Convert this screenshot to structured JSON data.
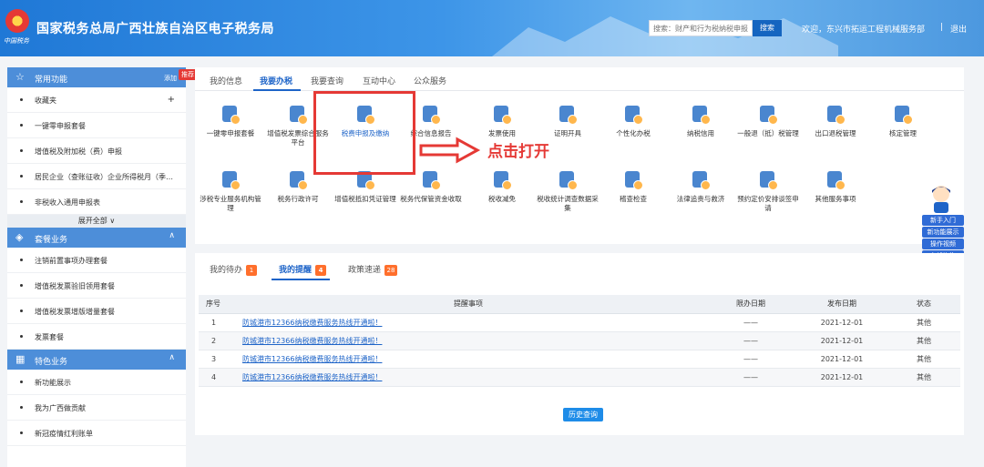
{
  "header": {
    "title": "国家税务总局广西壮族自治区电子税务局",
    "emblem_text": "中国税务",
    "search_placeholder": "搜索：财产和行为税纳税申报",
    "search_button": "搜索",
    "welcome": "欢迎，东兴市拓运工程机械服务部",
    "separator": "|",
    "logout": "退出"
  },
  "sidebar": {
    "recommend_badge": "推荐",
    "expand_all": "展开全部 ∨",
    "sections": [
      {
        "title": "常用功能",
        "action": "添加",
        "items": [
          "收藏夹",
          "一键零申报套餐",
          "增值税及附加税（费）申报",
          "居民企业（查账征收）企业所得税月（季…",
          "非税收入通用申报表"
        ]
      },
      {
        "title": "套餐业务",
        "items": [
          "注销前置事项办理套餐",
          "增值税发票验旧领用套餐",
          "增值税发票增版增量套餐",
          "发票套餐"
        ]
      },
      {
        "title": "特色业务",
        "items": [
          "新功能展示",
          "我为广西做贡献",
          "新冠疫情红利账单"
        ]
      }
    ]
  },
  "tabs": [
    "我的信息",
    "我要办税",
    "我要查询",
    "互动中心",
    "公众服务"
  ],
  "functions_row1": [
    "一键零申报套餐",
    "增值税发票综合服务平台",
    "税费申报及缴纳",
    "综合信息报告",
    "发票使用",
    "证明开具",
    "个性化办税",
    "纳税信用",
    "一般退（抵）税管理",
    "出口退税管理",
    "核定管理"
  ],
  "functions_row2": [
    "涉税专业服务机构管理",
    "税务行政许可",
    "增值税抵扣凭证管理",
    "税务代保管资金收取",
    "税收减免",
    "税收统计调查数据采集",
    "稽查检查",
    "法律追责与救济",
    "预约定价安排谈签申请",
    "其他服务事项"
  ],
  "annotation": {
    "text": "点击打开"
  },
  "helper": {
    "buttons": [
      "新手入门",
      "新功能展示",
      "操作视频",
      "在线咨询"
    ]
  },
  "bottom_tabs": [
    {
      "label": "我的待办",
      "count": "1"
    },
    {
      "label": "我的提醒",
      "count": "4"
    },
    {
      "label": "政策速递",
      "count": "28"
    }
  ],
  "table": {
    "headers": [
      "序号",
      "提醒事项",
      "限办日期",
      "发布日期",
      "状态"
    ],
    "rows": [
      [
        "1",
        "防城港市12366纳税缴费服务热线开通啦！",
        "——",
        "2021-12-01",
        "其他"
      ],
      [
        "2",
        "防城港市12366纳税缴费服务热线开通啦！",
        "——",
        "2021-12-01",
        "其他"
      ],
      [
        "3",
        "防城港市12366纳税缴费服务热线开通啦！",
        "——",
        "2021-12-01",
        "其他"
      ],
      [
        "4",
        "防城港市12366纳税缴费服务热线开通啦！",
        "——",
        "2021-12-01",
        "其他"
      ]
    ]
  },
  "history_button": "历史查询",
  "colors": {
    "brand": "#1f78d6",
    "accent": "#1e64c8",
    "highlight": "#e53935",
    "badge": "#ff6f2c"
  }
}
